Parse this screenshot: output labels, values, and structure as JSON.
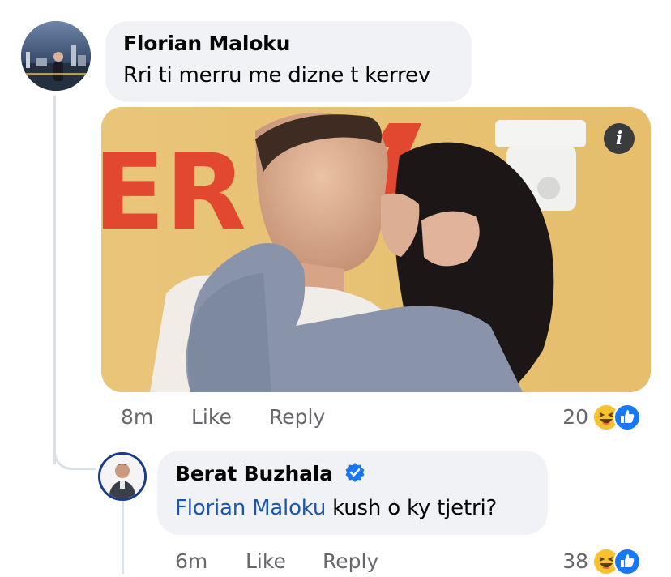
{
  "comments": [
    {
      "author": "Florian Maloku",
      "text": "Rri ti merru me dizne t kerrev",
      "time": "8m",
      "like_label": "Like",
      "reply_label": "Reply",
      "reaction_count": "20",
      "reactions": [
        "haha-emoji-icon",
        "like-emoji-icon"
      ],
      "gif": {
        "sign_text": "ER",
        "info_icon": "info-icon"
      }
    },
    {
      "author": "Berat Buzhala",
      "verified": true,
      "mention": "Florian Maloku",
      "text": " kush o ky tjetri?",
      "time": "6m",
      "like_label": "Like",
      "reply_label": "Reply",
      "reaction_count": "38",
      "reactions": [
        "haha-emoji-icon",
        "like-emoji-icon"
      ]
    }
  ],
  "colors": {
    "bubble": "#f0f2f5",
    "meta_text": "#65676b",
    "mention": "#1a56b0",
    "verified": "#1877f2",
    "like_reaction": "#1877f2",
    "haha_reaction": "#f7c12f"
  }
}
